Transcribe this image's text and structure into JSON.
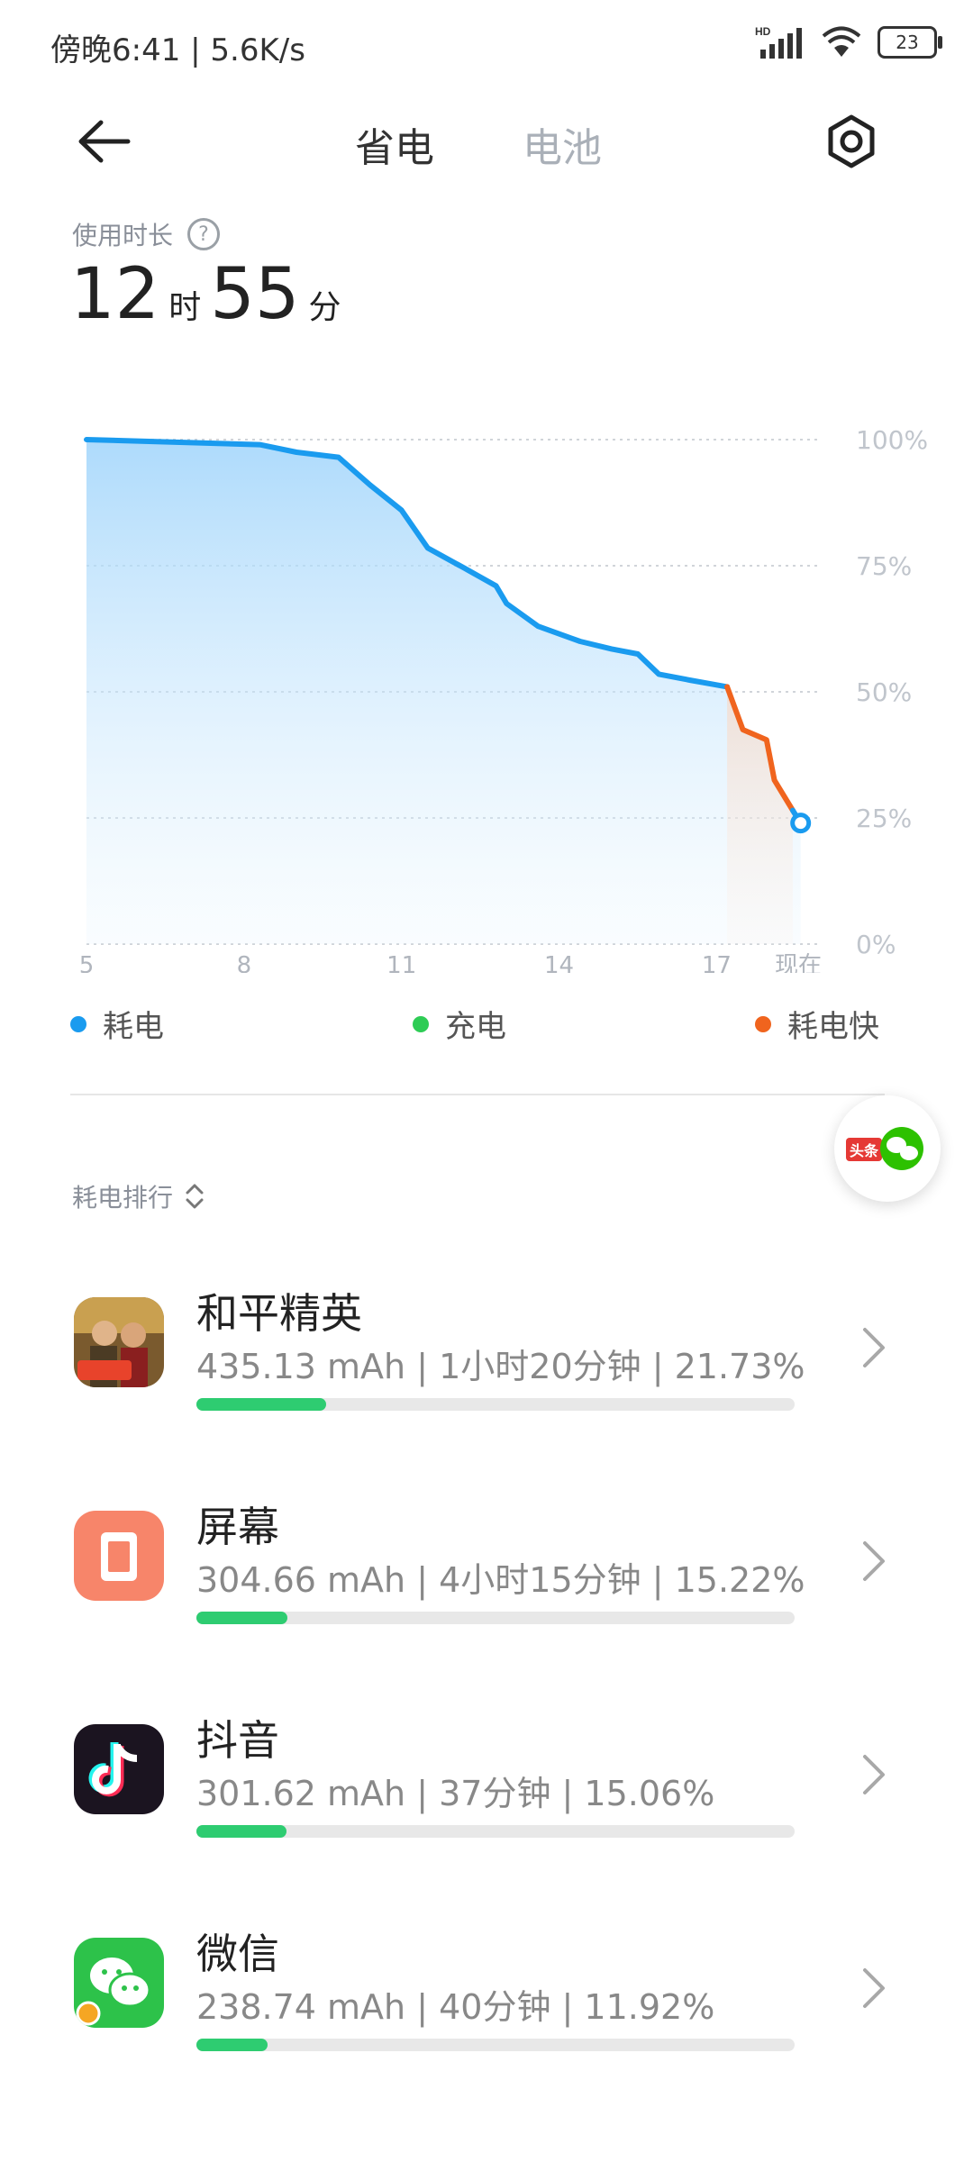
{
  "status_bar": {
    "time_speed": "傍晚6:41 | 5.6K/s",
    "network_badge": "HD",
    "battery_level": "23"
  },
  "header": {
    "tabs": [
      {
        "label": "省电",
        "active": true
      },
      {
        "label": "电池",
        "active": false
      }
    ]
  },
  "usage": {
    "label": "使用时长",
    "hours": "12",
    "hours_unit": "时",
    "minutes": "55",
    "minutes_unit": "分"
  },
  "chart_data": {
    "type": "line",
    "x_tick_labels": [
      "5",
      "8",
      "11",
      "14",
      "17",
      "现在"
    ],
    "y_tick_labels": [
      "100%",
      "75%",
      "50%",
      "25%",
      "0%"
    ],
    "ylim": [
      0,
      100
    ],
    "xlim": [
      5,
      19
    ],
    "grid": true,
    "series": [
      {
        "key": "normal",
        "color": "#1a9bef",
        "x": [
          5,
          8.3,
          9,
          9.8,
          10.4,
          11,
          11.5,
          12.2,
          12.8,
          13,
          13.6,
          14.4,
          15,
          15.5,
          15.9,
          16.5,
          17.2
        ],
        "y": [
          100,
          99,
          97.5,
          96.5,
          91,
          86,
          78.5,
          74.5,
          71,
          67.5,
          63,
          60,
          58.5,
          57.5,
          53.5,
          52.3,
          51
        ]
      },
      {
        "key": "fast",
        "color": "#f0641e",
        "x": [
          17.2,
          17.5,
          17.95,
          18.1,
          18.45
        ],
        "y": [
          51,
          42.5,
          40.5,
          32.5,
          26.5
        ]
      },
      {
        "key": "normal_tail",
        "color": "#1a9bef",
        "x": [
          18.45,
          18.6
        ],
        "y": [
          26.5,
          24
        ]
      }
    ]
  },
  "legend": [
    {
      "label": "耗电",
      "color": "#1a9bef"
    },
    {
      "label": "充电",
      "color": "#2ecc55"
    },
    {
      "label": "耗电快",
      "color": "#f0641e"
    }
  ],
  "ranking": {
    "label": "耗电排行",
    "apps": [
      {
        "name": "和平精英",
        "detail": "435.13 mAh | 1小时20分钟 | 21.73%",
        "percent": 21.73,
        "icon": "game-icon"
      },
      {
        "name": "屏幕",
        "detail": "304.66 mAh | 4小时15分钟 | 15.22%",
        "percent": 15.22,
        "icon": "screen-icon"
      },
      {
        "name": "抖音",
        "detail": "301.62 mAh | 37分钟 | 15.06%",
        "percent": 15.06,
        "icon": "tiktok-icon"
      },
      {
        "name": "微信",
        "detail": "238.74 mAh | 40分钟 | 11.92%",
        "percent": 11.92,
        "icon": "wechat-icon"
      }
    ]
  },
  "float_widget": {
    "badge": "头条"
  }
}
